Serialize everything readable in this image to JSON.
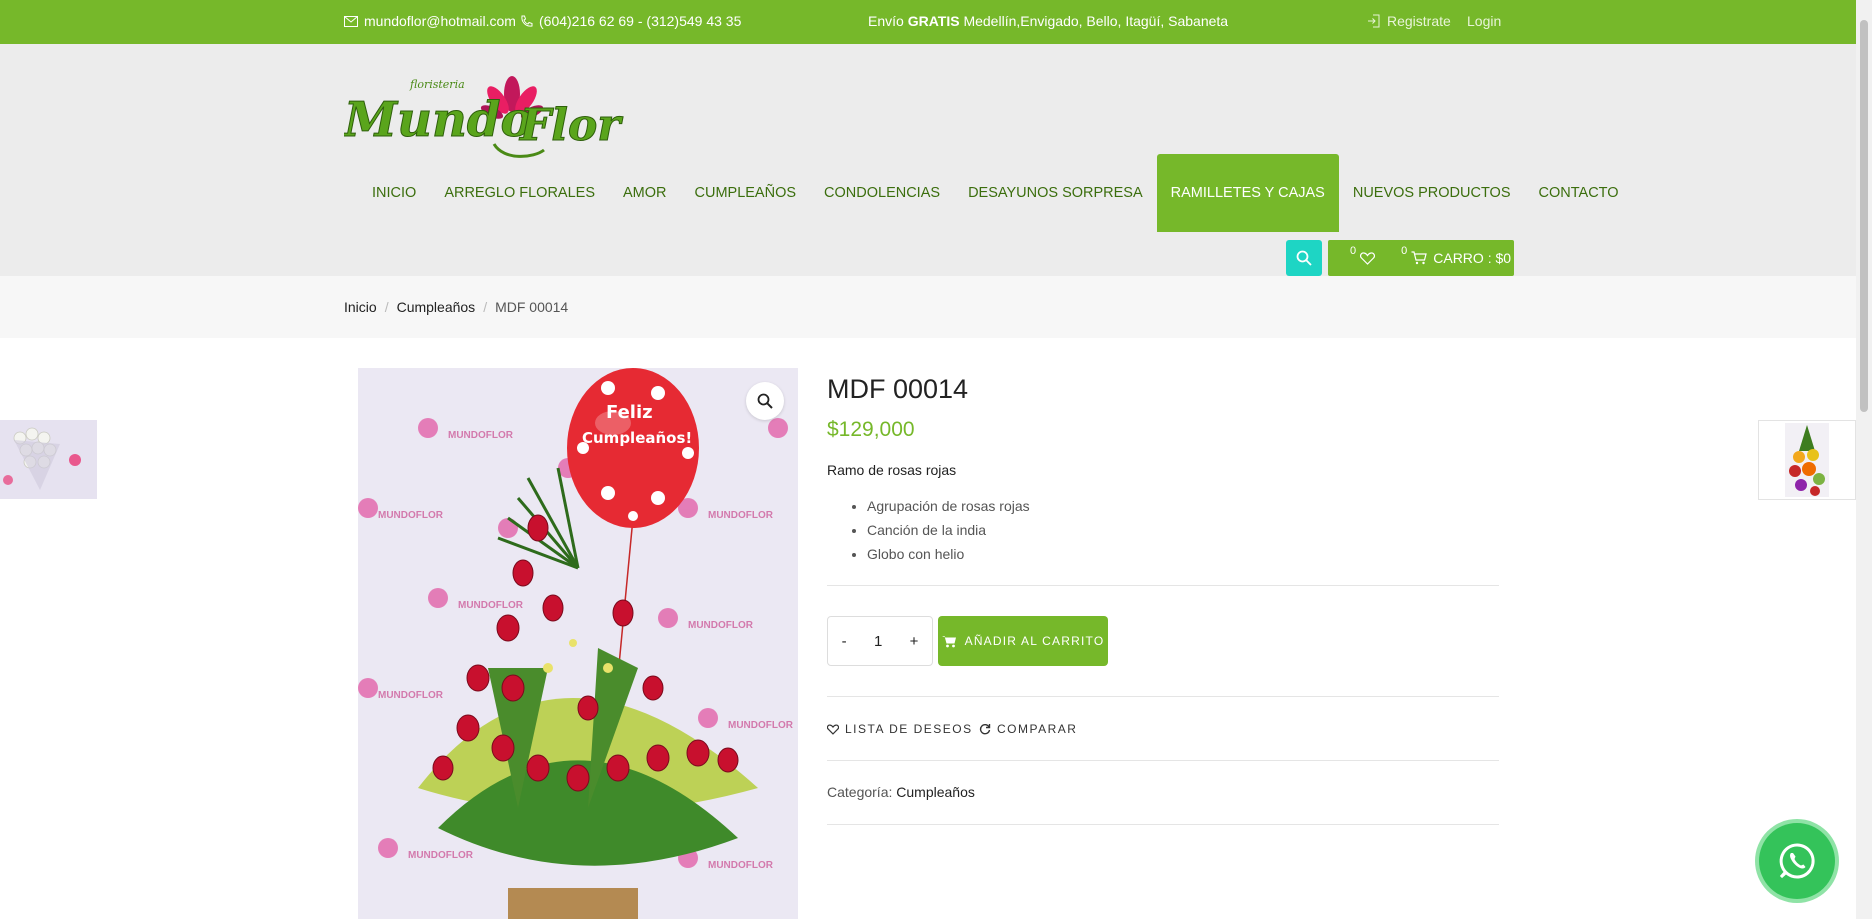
{
  "topbar": {
    "email": "mundoflor@hotmail.com",
    "phone": "(604)216 62 69 - (312)549 43 35",
    "promo_prefix": "Envío ",
    "promo_bold": "GRATIS",
    "promo_suffix": " Medellín,Envigado, Bello, Itagüí, Sabaneta",
    "register": "Registrate",
    "login": "Login"
  },
  "logo": {
    "top": "floristeria",
    "main": "Mundo Flor"
  },
  "nav": {
    "items": [
      {
        "label": "INICIO"
      },
      {
        "label": "ARREGLO FLORALES"
      },
      {
        "label": "AMOR"
      },
      {
        "label": "CUMPLEAÑOS"
      },
      {
        "label": "CONDOLENCIAS"
      },
      {
        "label": "DESAYUNOS SORPRESA"
      },
      {
        "label": "RAMILLETES Y CAJAS"
      },
      {
        "label": "NUEVOS PRODUCTOS"
      },
      {
        "label": "CONTACTO"
      }
    ],
    "active": "RAMILLETES Y CAJAS"
  },
  "cart": {
    "wishlist_count": "0",
    "cart_count": "0",
    "label": "CARRO : $0"
  },
  "breadcrumb": {
    "home": "Inicio",
    "category": "Cumpleaños",
    "current": "MDF 00014"
  },
  "product": {
    "title": "MDF 00014",
    "price": "$129,000",
    "short_description": "Ramo de rosas rojas",
    "features": [
      "Agrupación de rosas rojas",
      "Canción de la india",
      "Globo con helio"
    ],
    "quantity": "1",
    "qty_minus": "-",
    "qty_plus": "+",
    "add_to_cart": "AÑADIR AL CARRITO",
    "wishlist": "LISTA DE DESEOS",
    "compare": "COMPARAR",
    "category_label": "Categoría:",
    "category_value": "Cumpleaños",
    "balloon_text_1": "Feliz",
    "balloon_text_2": "Cumpleaños!",
    "backdrop_text": "MUNDOFLOR"
  },
  "colors": {
    "brand_green": "#76b82a",
    "search_teal": "#1ed5c4",
    "nav_text": "#3b6e0d",
    "whatsapp": "#34c35a"
  }
}
